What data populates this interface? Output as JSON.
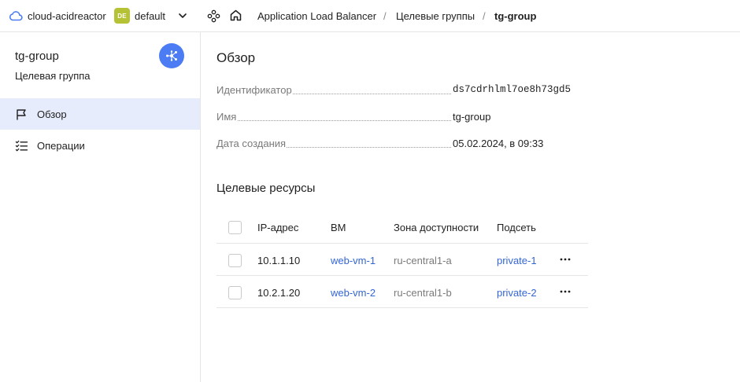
{
  "topbar": {
    "cloud_name": "cloud-acidreactor",
    "folder_badge": "DE",
    "folder_name": "default",
    "breadcrumbs": [
      {
        "label": "Application Load Balancer"
      },
      {
        "label": "Целевые группы"
      },
      {
        "label": "tg-group"
      }
    ],
    "separator": "/"
  },
  "sidebar": {
    "title": "tg-group",
    "subtitle": "Целевая группа",
    "items": [
      {
        "label": "Обзор",
        "icon": "flag-icon",
        "active": true
      },
      {
        "label": "Операции",
        "icon": "list-checks-icon",
        "active": false
      }
    ]
  },
  "overview": {
    "heading": "Обзор",
    "fields": [
      {
        "key": "Идентификатор",
        "value": "ds7cdrhlml7oe8h73gd5"
      },
      {
        "key": "Имя",
        "value": "tg-group"
      },
      {
        "key": "Дата создания",
        "value": "05.02.2024, в 09:33"
      }
    ]
  },
  "resources": {
    "heading": "Целевые ресурсы",
    "columns": [
      "IP-адрес",
      "ВМ",
      "Зона доступности",
      "Подсеть"
    ],
    "rows": [
      {
        "ip": "10.1.1.10",
        "vm": "web-vm-1",
        "zone": "ru-central1-a",
        "subnet": "private-1"
      },
      {
        "ip": "10.2.1.20",
        "vm": "web-vm-2",
        "zone": "ru-central1-b",
        "subnet": "private-2"
      }
    ]
  },
  "colors": {
    "accent": "#4b7cf3",
    "link": "#3366d6",
    "active_nav": "#e6ecfc",
    "folder_badge": "#b6c235"
  }
}
